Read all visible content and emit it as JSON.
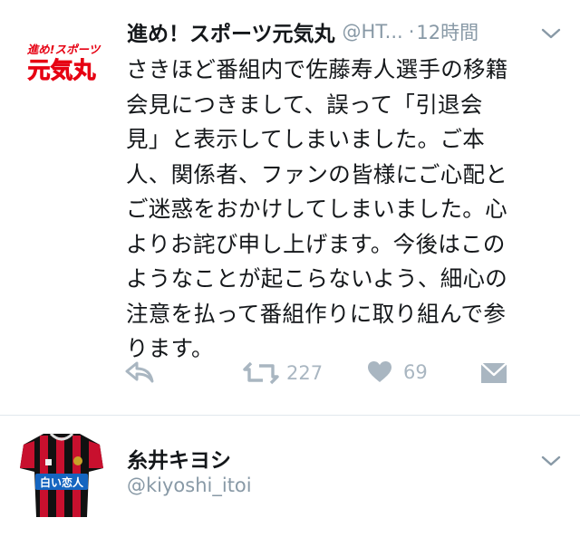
{
  "tweet": {
    "display_name": "進め！スポーツ元気丸",
    "handle": "@HT...",
    "separator": "·",
    "time": "12時間",
    "logo_top_text": "進め!スポーツ",
    "logo_main_text": "元気丸",
    "text": "さきほど番組内で佐藤寿人選手の移籍\n会見につきまして、誤って「引退会\n見」と表示してしまいました。ご本\n人、関係者、ファンの皆様にご心配と\nご迷惑をおかけしてしまいました。心\nよりお詫び申し上げます。今後はこの\nようなことが起こらないよう、細心の\n注意を払って番組作りに取り組んで参\nります。",
    "retweet_count": "227",
    "like_count": "69"
  },
  "user": {
    "name": "糸井キヨシ",
    "handle": "@kiyoshi_itoi",
    "jersey_text": "白い恋人"
  },
  "colors": {
    "text_primary": "#14171a",
    "text_secondary": "#8899a6",
    "icon_gray": "#a9b6c1",
    "logo_red": "#e60012",
    "jersey_red": "#c8102e",
    "jersey_black": "#111111",
    "jersey_blue": "#1565c0"
  },
  "icons": [
    "reply-icon",
    "retweet-icon",
    "heart-icon",
    "dm-envelope-icon",
    "chevron-down-icon"
  ]
}
